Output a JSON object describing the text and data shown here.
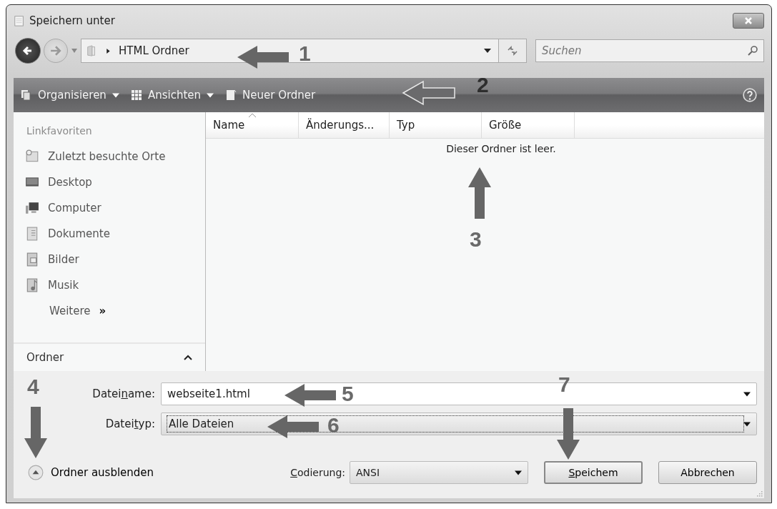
{
  "window": {
    "title": "Speichern unter"
  },
  "address": {
    "path": "HTML Ordner"
  },
  "search": {
    "placeholder": "Suchen"
  },
  "toolbar": [
    {
      "label": "Organisieren",
      "kind": "menu"
    },
    {
      "label": "Ansichten",
      "kind": "menu"
    },
    {
      "label": "Neuer Ordner",
      "kind": "button"
    }
  ],
  "sidebar": {
    "heading": "Linkfavoriten",
    "items": [
      {
        "label": "Zuletzt besuchte Orte",
        "kind": "recent"
      },
      {
        "label": "Desktop",
        "kind": "desktop"
      },
      {
        "label": "Computer",
        "kind": "computer"
      },
      {
        "label": "Dokumente",
        "kind": "documents"
      },
      {
        "label": "Bilder",
        "kind": "pictures"
      },
      {
        "label": "Musik",
        "kind": "music"
      }
    ],
    "more": "Weitere",
    "more_glyph": "»",
    "folders": "Ordner"
  },
  "table": {
    "columns": [
      "Name",
      "Änderungs...",
      "Typ",
      "Größe"
    ],
    "empty_message": "Dieser Ordner ist leer."
  },
  "filename": {
    "label": {
      "before": "Datei",
      "key": "n",
      "after": "ame:"
    },
    "value": "webseite1.html"
  },
  "filetype": {
    "label": {
      "before": "Datei",
      "key": "t",
      "after": "yp:"
    },
    "value": "Alle Dateien"
  },
  "hide_folders": "Ordner ausblenden",
  "encoding": {
    "label": {
      "key": "C",
      "after": "odierung:"
    },
    "value": "ANSI"
  },
  "buttons": [
    {
      "label": {
        "key": "S",
        "after": "peichem"
      },
      "kind": "default"
    },
    {
      "label": {
        "before": "Abbrechen"
      },
      "kind": "normal"
    }
  ],
  "callouts": [
    {
      "number": "1",
      "kind": "left"
    },
    {
      "number": "2",
      "kind": "hollow"
    },
    {
      "number": "3",
      "kind": "up"
    },
    {
      "number": "4",
      "kind": "down"
    },
    {
      "number": "5",
      "kind": "left"
    },
    {
      "number": "6",
      "kind": "left"
    },
    {
      "number": "7",
      "kind": "down"
    }
  ]
}
